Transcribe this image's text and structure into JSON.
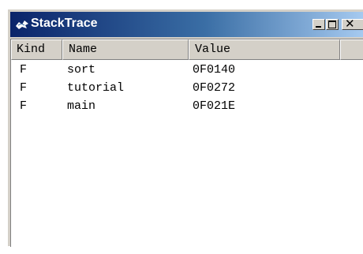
{
  "window": {
    "title": "StackTrace",
    "close_glyph": "✕",
    "icons": {
      "title": "stacktrace-app-icon",
      "minimize": "minimize-icon",
      "maximize": "maximize-icon",
      "close": "close-icon"
    }
  },
  "table": {
    "columns": [
      "Kind",
      "Name",
      "Value",
      ""
    ],
    "rows": [
      {
        "kind": "F",
        "name": "sort",
        "value": "0F0140"
      },
      {
        "kind": "F",
        "name": "tutorial",
        "value": "0F0272"
      },
      {
        "kind": "F",
        "name": "main",
        "value": "0F021E"
      }
    ]
  },
  "colors": {
    "title_gradient_start": "#0a246a",
    "title_gradient_end": "#a6caf0",
    "chrome": "#d4d0c8",
    "content_bg": "#ffffff"
  }
}
